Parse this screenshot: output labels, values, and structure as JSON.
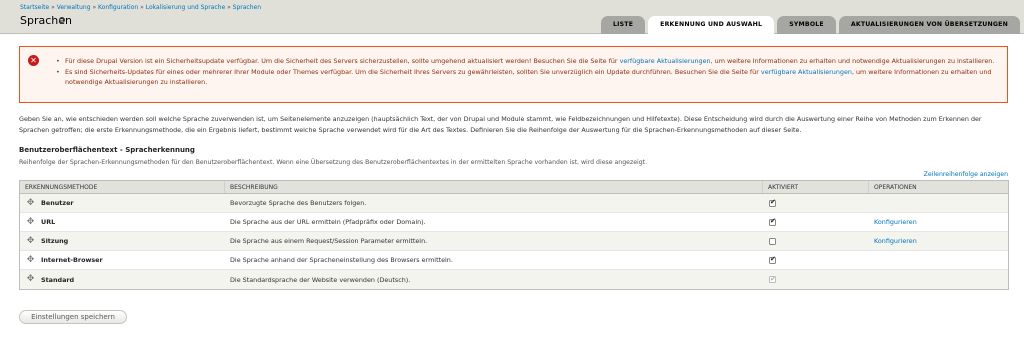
{
  "breadcrumb": {
    "items": [
      "Startseite",
      "Verwaltung",
      "Konfiguration",
      "Lokalisierung und Sprache",
      "Sprachen"
    ],
    "separator": "»"
  },
  "page_title": "Sprachen",
  "tabs": [
    {
      "label": "Liste",
      "active": false
    },
    {
      "label": "Erkennung und Auswahl",
      "active": true
    },
    {
      "label": "Symbole",
      "active": false
    },
    {
      "label": "Aktualisierungen von Übersetzungen",
      "active": false
    }
  ],
  "messages": {
    "type": "error",
    "items": [
      {
        "before": "Für diese Drupal Version ist ein Sicherheitsupdate verfügbar. Um die Sicherheit des Servers sicherzustellen, sollte umgehend aktualisiert werden! Besuchen Sie die Seite für ",
        "link": "verfügbare Aktualisierungen",
        "after": ", um weitere Informationen zu erhalten und notwendige Aktualisierungen zu installieren."
      },
      {
        "before": "Es sind Sicherheits-Updates für eines oder mehrerer Ihrer Module oder Themes verfügbar. Um die Sicherheit Ihres Servers zu gewährleisten, sollten Sie unverzüglich ein Update durchführen. Besuchen Sie die Seite für ",
        "link": "verfügbare Aktualisierungen",
        "after": ", um weitere Informationen zu erhalten und notwendige Aktualisierungen zu installieren."
      }
    ]
  },
  "intro": "Geben Sie an, wie entschieden werden soll welche Sprache zuverwenden ist, um Seitenelemente anzuzeigen (hauptsächlich Text, der von Drupal und Module stammt, wie Feldbezeichnungen und Hilfetexte). Diese Entscheidung wird durch die Auswertung einer Reihe von Methoden zum Erkennen der Sprachen getroffen; die erste Erkennungsmethode, die ein Ergebnis liefert, bestimmt welche Sprache verwendet wird für die Art des Textes. Definieren Sie die Reihenfolge der Auswertung für die Sprachen-Erkennungsmethoden auf dieser Seite.",
  "section": {
    "title": "Benutzeroberflächentext - Spracherkennung",
    "description": "Reihenfolge der Sprachen-Erkennungsmethoden für den Benutzeroberflächentext. Wenn eine Übersetzung des Benutzeroberflächentextes in der ermittelten Sprache vorhanden ist, wird diese angezeigt.",
    "row_weights_link": "Zeilenreihenfolge anzeigen"
  },
  "table": {
    "headers": [
      "Erkennungsmethode",
      "Beschreibung",
      "Aktiviert",
      "Operationen"
    ],
    "rows": [
      {
        "method": "Benutzer",
        "description": "Bevorzugte Sprache des Benutzers folgen.",
        "enabled": true,
        "disabled": false,
        "operation": ""
      },
      {
        "method": "URL",
        "description": "Die Sprache aus der URL ermitteln (Pfadpräfix oder Domain).",
        "enabled": true,
        "disabled": false,
        "operation": "Konfigurieren"
      },
      {
        "method": "Sitzung",
        "description": "Die Sprache aus einem Request/Session Parameter ermitteln.",
        "enabled": false,
        "disabled": false,
        "operation": "Konfigurieren"
      },
      {
        "method": "Internet-Browser",
        "description": "Die Sprache anhand der Spracheneinstellung des Browsers ermitteln.",
        "enabled": true,
        "disabled": false,
        "operation": ""
      },
      {
        "method": "Standard",
        "description": "Die Standardsprache der Website verwenden (Deutsch).",
        "enabled": true,
        "disabled": true,
        "operation": ""
      }
    ]
  },
  "save_button": "Einstellungen speichern",
  "colors": {
    "link": "#0074bd",
    "error_border": "#ed541d",
    "error_text": "#8c2e0b",
    "header_bg": "#e0e0d8"
  }
}
